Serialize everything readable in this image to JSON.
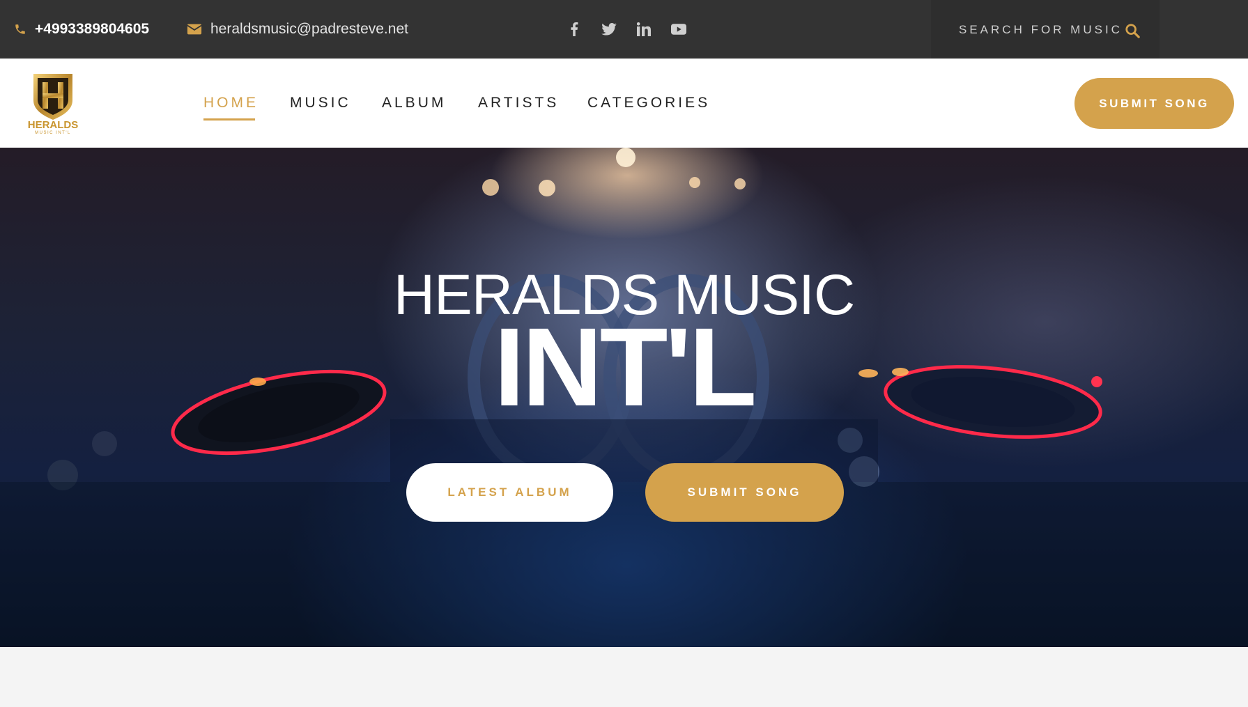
{
  "topbar": {
    "phone": "+4993389804605",
    "email": "heraldsmusic@padresteve.net",
    "socials": [
      {
        "name": "facebook-icon"
      },
      {
        "name": "twitter-icon"
      },
      {
        "name": "linkedin-icon"
      },
      {
        "name": "youtube-icon"
      }
    ],
    "search_placeholder": "SEARCH FOR MUSIC"
  },
  "nav": {
    "logo_text": "HERALDS",
    "logo_subtext": "MUSIC INT'L",
    "links": [
      "HOME",
      "MUSIC",
      "ALBUM",
      "ARTISTS",
      "CATEGORIES"
    ],
    "active": "HOME",
    "submit_label": "SUBMIT SONG"
  },
  "hero": {
    "title_line1": "HERALDS MUSIC",
    "title_line2": "INT'L",
    "latest_album_label": "LATEST ALBUM",
    "submit_song_label": "SUBMIT SONG"
  },
  "colors": {
    "accent": "#d4a24c",
    "topbar_bg": "#333333",
    "turntable_ring": "#ff2a4a"
  }
}
